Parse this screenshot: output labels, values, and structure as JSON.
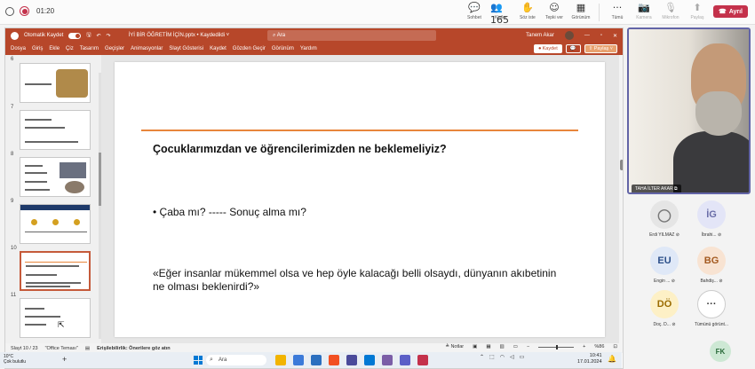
{
  "teams": {
    "timer": "01:20",
    "items": [
      {
        "icon": "💬",
        "label": "Sohbet",
        "name": "chat"
      },
      {
        "icon": "👥165",
        "label": "Kişiler",
        "name": "people"
      },
      {
        "icon": "✋",
        "label": "Söz iste",
        "name": "raise-hand"
      },
      {
        "icon": "☺",
        "label": "Tepki ver",
        "name": "react"
      },
      {
        "icon": "▦",
        "label": "Görünüm",
        "name": "view"
      },
      {
        "icon": "···",
        "label": "Tümü",
        "name": "more"
      },
      {
        "icon": "📷",
        "label": "Kamera",
        "name": "camera",
        "dim": true
      },
      {
        "icon": "🎙",
        "label": "Mikrofon",
        "name": "mic",
        "dim": true
      },
      {
        "icon": "⬆",
        "label": "Paylaş",
        "name": "share",
        "dim": true
      }
    ],
    "leave_label": "Ayrıl"
  },
  "ppt": {
    "autosave": "Otomatik Kaydet",
    "filename": "İYİ BİR ÖĞRETİM İÇİN.pptx • Kaydedildi ˅",
    "search": "Ara",
    "user": "Tanem Akar",
    "menu": [
      "Dosya",
      "Giriş",
      "Ekle",
      "Çiz",
      "Tasarım",
      "Geçişler",
      "Animasyonlar",
      "Slayt Gösterisi",
      "Kaydet",
      "Gözden Geçir",
      "Görünüm",
      "Yardım"
    ],
    "save_btn": "⏺ Kaydet",
    "share_btn": "⇧ Paylaş ˅",
    "thumb_numbers": [
      "6",
      "7",
      "8",
      "9",
      "10",
      "11"
    ],
    "slide": {
      "title": "Çocuklarımızdan ve öğrencilerimizden ne beklemeliyiz?",
      "bullet": "• Çaba mı?  -----  Sonuç alma mı?",
      "quote": "«Eğer insanlar mükemmel olsa ve hep öyle kalacağı belli olsaydı, dünyanın akıbetinin ne olması beklenirdi?»"
    },
    "status": {
      "slide_num": "Slayt 10 / 23",
      "theme": "\"Office Teması\"",
      "access": "Erişilebilirlik: Önerilere göz atın",
      "notes": "≜ Notlar",
      "zoom": "%86"
    }
  },
  "taskbar": {
    "weather_temp": "10°C",
    "weather_desc": "Çok bulutlu",
    "search": "Ara",
    "time": "10:41",
    "date": "17.01.2024",
    "app_colors": [
      "#f2b400",
      "#3b7ad9",
      "#2b6fbf",
      "#f25022",
      "#4a4a9a",
      "#0078d4",
      "#7b5ea7",
      "#5b5fc7",
      "#c4314b"
    ]
  },
  "side": {
    "presenter": "TAHA İLTER AKAR",
    "participants": [
      {
        "initials": "",
        "name": "Erdi YILMAZ",
        "bg": "#e5e5e5",
        "color": "#777"
      },
      {
        "initials": "İG",
        "name": "İbrahi...",
        "bg": "#e3e5f7",
        "color": "#6a6ea8"
      },
      {
        "initials": "EU",
        "name": "Engin ...",
        "bg": "#dfe8f7",
        "color": "#2b4f8a"
      },
      {
        "initials": "BG",
        "name": "Bahdiş...",
        "bg": "#f8e3d2",
        "color": "#a45a20"
      },
      {
        "initials": "DÖ",
        "name": "Doç. D...",
        "bg": "#fdf0c6",
        "color": "#9a6b00"
      },
      {
        "initials": "···",
        "name": "Tümünü görünt...",
        "bg": "#fff",
        "color": "#333"
      }
    ],
    "fk": "FK"
  }
}
